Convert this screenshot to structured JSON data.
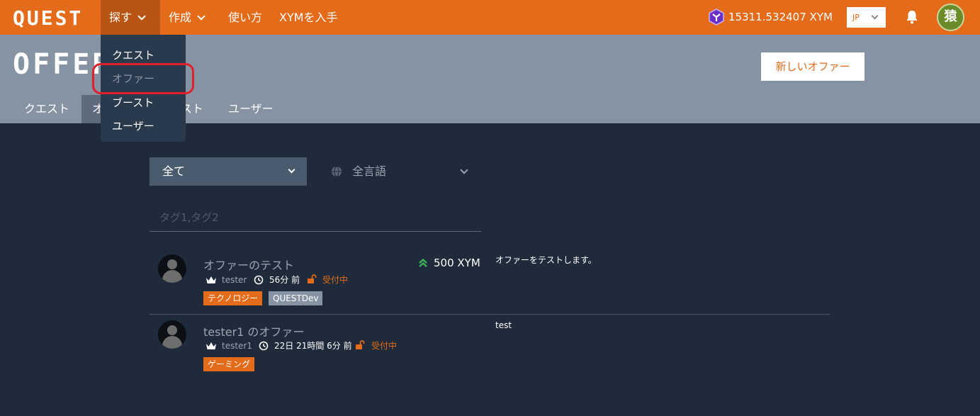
{
  "topnav": {
    "logo": "QUEST",
    "items": [
      {
        "label": "探す",
        "has_dropdown": true,
        "active": true
      },
      {
        "label": "作成",
        "has_dropdown": true,
        "active": false
      },
      {
        "label": "使い方",
        "has_dropdown": false,
        "active": false
      },
      {
        "label": "XYMを入手",
        "has_dropdown": false,
        "active": false
      }
    ],
    "balance": "15311.532407 XYM",
    "language": "JP",
    "accent_color": "#e36b1a"
  },
  "header": {
    "title": "OFFER",
    "new_offer_button": "新しいオファー",
    "subtabs": [
      "クエスト",
      "オ",
      "スト",
      "ユーザー"
    ]
  },
  "dropdown": {
    "items": [
      {
        "label": "クエスト",
        "highlighted": false
      },
      {
        "label": "オファー",
        "highlighted": true
      },
      {
        "label": "ブースト",
        "highlighted": false
      },
      {
        "label": "ユーザー",
        "highlighted": false
      }
    ]
  },
  "filters": {
    "category": "全て",
    "language": "全言語",
    "tag_placeholder": "タグ1,タグ2"
  },
  "offers": [
    {
      "title": "オファーのテスト",
      "user": "tester",
      "time": "56分 前",
      "status": "受付中",
      "tags": [
        "テクノロジー",
        "QUESTDev"
      ],
      "reward": "500 XYM",
      "description": "オファーをテストします。"
    },
    {
      "title": "tester1 のオファー",
      "user": "tester1",
      "time": "22日 21時間 6分 前",
      "status": "受付中",
      "tags": [
        "ゲーミング"
      ],
      "reward": "",
      "description": "test"
    }
  ]
}
